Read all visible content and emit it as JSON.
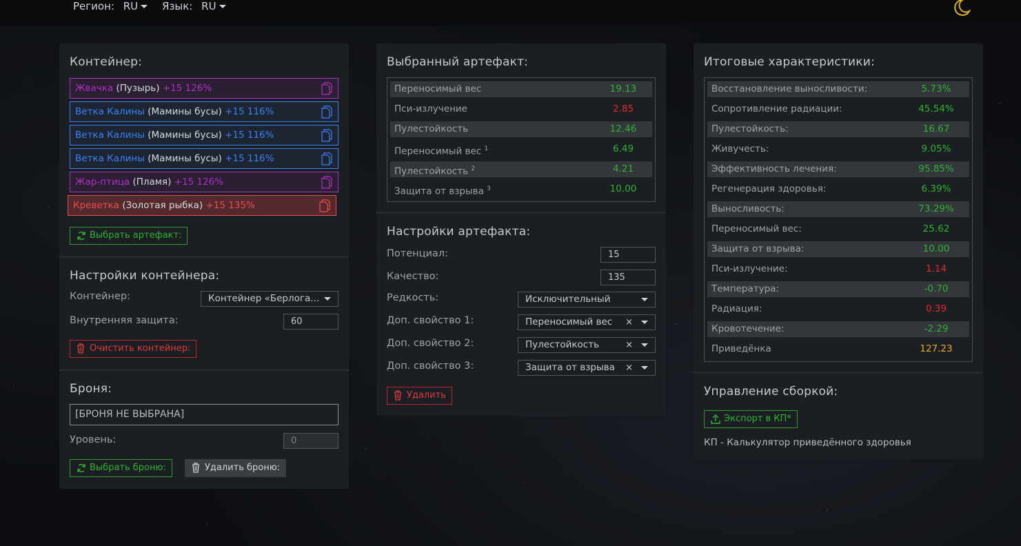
{
  "topbar": {
    "region_label": "Регион:",
    "region_value": "RU",
    "lang_label": "Язык:",
    "lang_value": "RU"
  },
  "colors": {
    "legendary": "#b22fc5",
    "rare": "#3b82f6",
    "unique": "#e84c4c",
    "positive": "#2fb42f",
    "negative": "#e02a2a",
    "total": "#e0b023"
  },
  "container": {
    "title": "Контейнер:",
    "slots": [
      {
        "name": "Жвачка",
        "base": "(Пузырь)",
        "bonus": "+15 126%"
      },
      {
        "name": "Ветка Калины",
        "base": "(Мамины бусы)",
        "bonus": "+15 116%"
      },
      {
        "name": "Ветка Калины",
        "base": "(Мамины бусы)",
        "bonus": "+15 116%"
      },
      {
        "name": "Ветка Калины",
        "base": "(Мамины бусы)",
        "bonus": "+15 116%"
      },
      {
        "name": "Жар-птица",
        "base": "(Пламя)",
        "bonus": "+15 126%"
      },
      {
        "name": "Креветка",
        "base": "(Золотая рыбка)",
        "bonus": "+15 135%"
      }
    ],
    "choose_button": "Выбрать артефакт:"
  },
  "container_settings": {
    "title": "Настройки контейнера:",
    "container_label": "Контейнер:",
    "container_value": "Контейнер «Берлога...",
    "protection_label": "Внутренняя защита:",
    "protection_value": "60",
    "clear_button": "Очистить контейнер:"
  },
  "armor": {
    "title": "Броня:",
    "selected": "[БРОНЯ НЕ ВЫБРАНА]",
    "level_label": "Уровень:",
    "level_value": "0",
    "choose_button": "Выбрать броню:",
    "delete_button": "Удалить броню:"
  },
  "selected_artifact": {
    "title": "Выбранный артефакт:",
    "stats": [
      {
        "name": "Переносимый вес",
        "sup": "",
        "value": "19.13",
        "tone": "g"
      },
      {
        "name": "Пси-излучение",
        "sup": "",
        "value": "2.85",
        "tone": "r"
      },
      {
        "name": "Пулестойкость",
        "sup": "",
        "value": "12.46",
        "tone": "g"
      },
      {
        "name": "Переносимый вес",
        "sup": "1",
        "value": "6.49",
        "tone": "g"
      },
      {
        "name": "Пулестойкость",
        "sup": "2",
        "value": "4.21",
        "tone": "g"
      },
      {
        "name": "Защита от взрыва",
        "sup": "3",
        "value": "10.00",
        "tone": "g"
      }
    ]
  },
  "artifact_settings": {
    "title": "Настройки артефакта:",
    "potential_label": "Потенциал:",
    "potential_value": "15",
    "quality_label": "Качество:",
    "quality_value": "135",
    "rarity_label": "Редкость:",
    "rarity_value": "Исключительный",
    "prop1_label": "Доп. свойство 1:",
    "prop1_value": "Переносимый вес",
    "prop2_label": "Доп. свойство 2:",
    "prop2_value": "Пулестойкость",
    "prop3_label": "Доп. свойство 3:",
    "prop3_value": "Защита от взрыва",
    "clear_x": "×",
    "delete_button": "Удалить"
  },
  "totals": {
    "title": "Итоговые характеристики:",
    "stats": [
      {
        "name": "Восстановление выносливости:",
        "value": "5.73%",
        "tone": "g"
      },
      {
        "name": "Сопротивление радиации:",
        "value": "45.54%",
        "tone": "g"
      },
      {
        "name": "Пулестойкость:",
        "value": "16.67",
        "tone": "g"
      },
      {
        "name": "Живучесть:",
        "value": "9.05%",
        "tone": "g"
      },
      {
        "name": "Эффективность лечения:",
        "value": "95.85%",
        "tone": "g"
      },
      {
        "name": "Регенерация здоровья:",
        "value": "6.39%",
        "tone": "g"
      },
      {
        "name": "Выносливость:",
        "value": "73.29%",
        "tone": "g"
      },
      {
        "name": "Переносимый вес:",
        "value": "25.62",
        "tone": "g"
      },
      {
        "name": "Защита от взрыва:",
        "value": "10.00",
        "tone": "g"
      },
      {
        "name": "Пси-излучение:",
        "value": "1.14",
        "tone": "r"
      },
      {
        "name": "Температура:",
        "value": "-0.70",
        "tone": "g"
      },
      {
        "name": "Радиация:",
        "value": "0.39",
        "tone": "r"
      },
      {
        "name": "Кровотечение:",
        "value": "-2.29",
        "tone": "g"
      },
      {
        "name": "Приведёнка",
        "value": "127.23",
        "tone": "y"
      }
    ]
  },
  "build": {
    "title": "Управление сборкой:",
    "export_button": "Экспорт в КП*",
    "note": "КП - Калькулятор приведённого здоровья"
  }
}
